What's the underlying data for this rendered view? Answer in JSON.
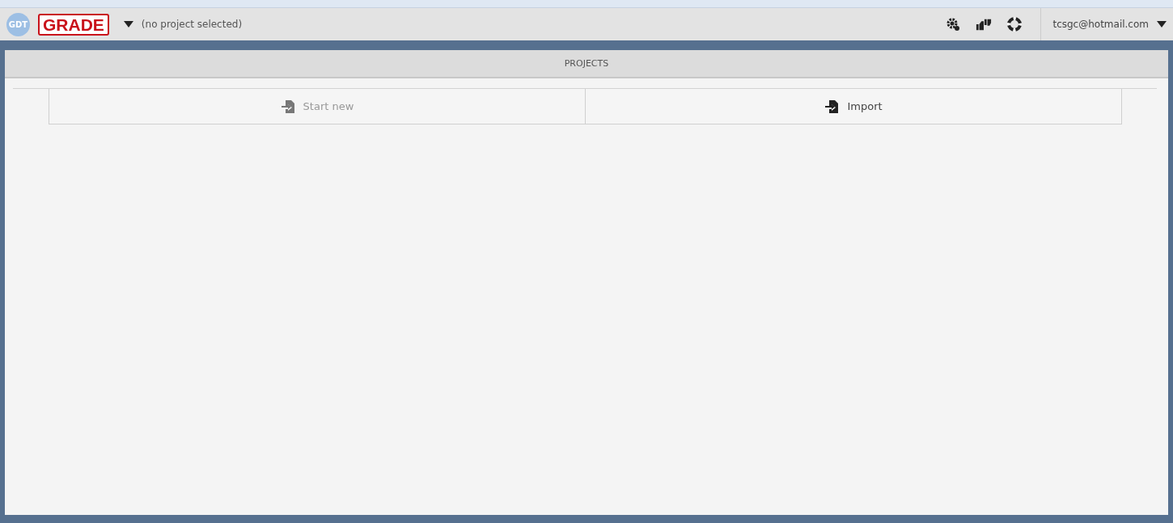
{
  "header": {
    "logo_badge": "GDT",
    "logo_text": "GRADE",
    "project": "(no project selected)",
    "user": "tcsgc@hotmail.com"
  },
  "panel": {
    "title": "PROJECTS",
    "actions": [
      {
        "label": "Start new",
        "disabled": true
      },
      {
        "label": "Import",
        "disabled": false
      }
    ]
  }
}
